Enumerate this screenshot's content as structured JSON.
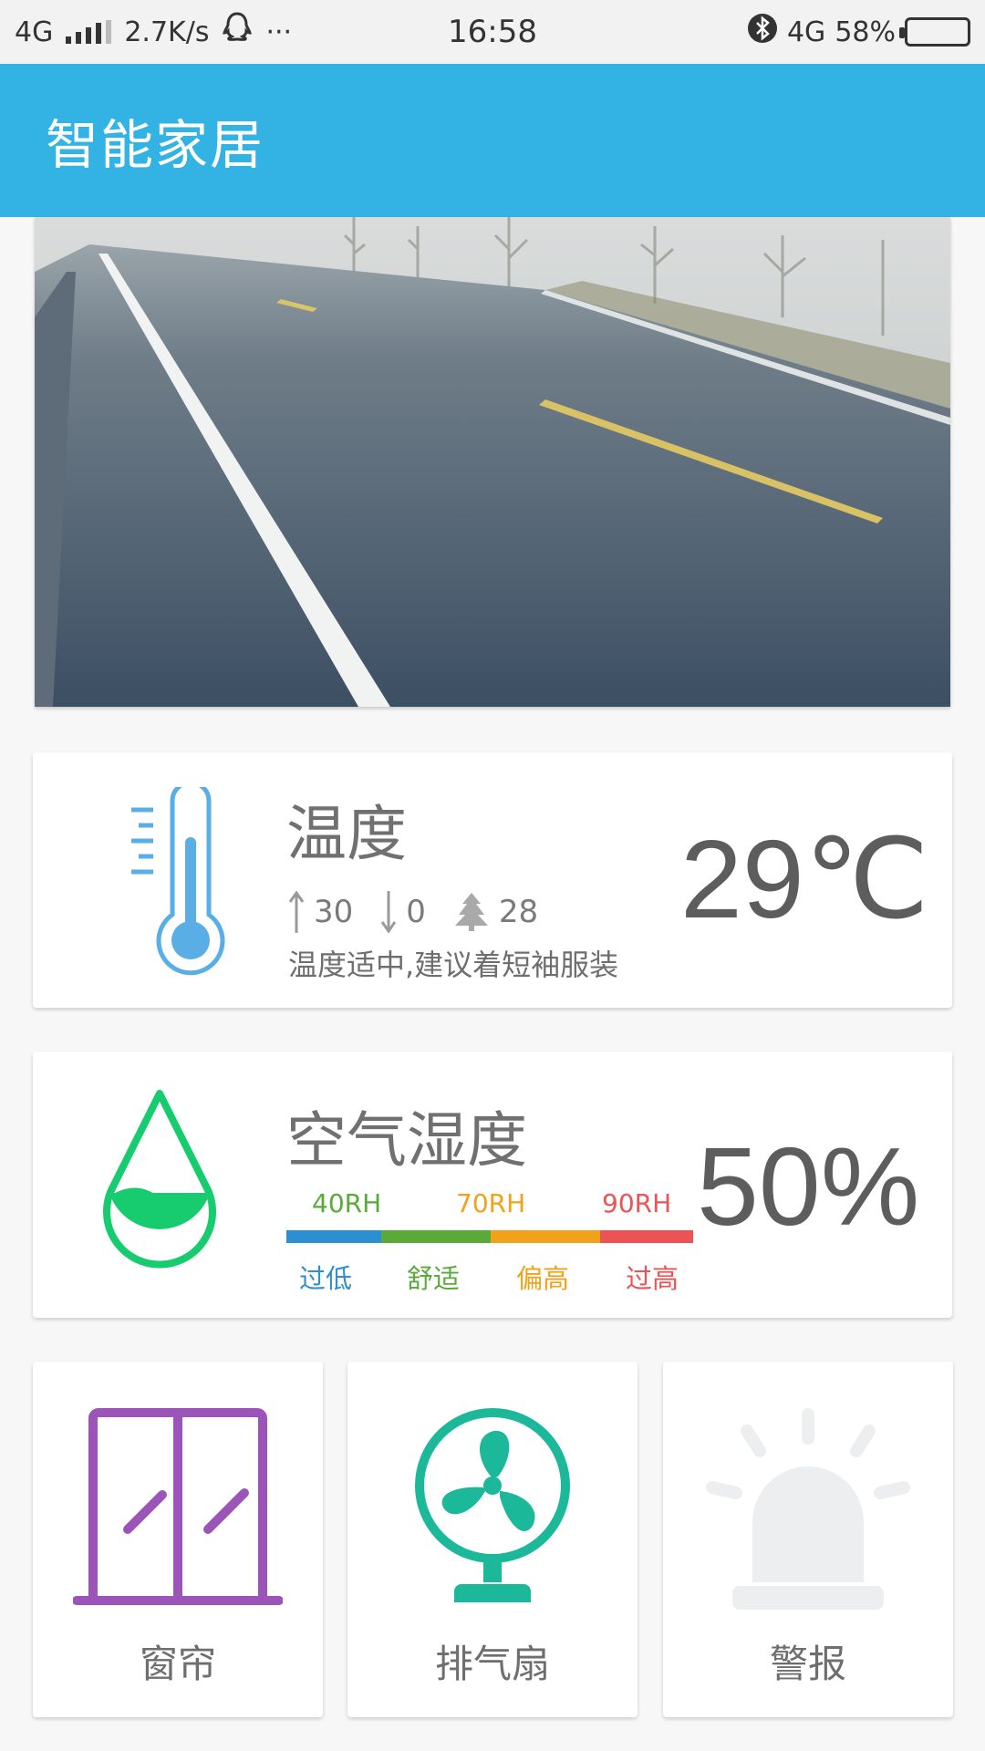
{
  "status_bar": {
    "network": "4G",
    "speed": "2.7K/s",
    "more": "···",
    "time": "16:58",
    "network_right": "4G",
    "battery": "58%",
    "battery_level": 0.58
  },
  "app_bar": {
    "title": "智能家居"
  },
  "temperature": {
    "title": "温度",
    "high": "30",
    "low": "0",
    "feels": "28",
    "advice": "温度适中,建议着短袖服装",
    "value": "29℃"
  },
  "humidity": {
    "title": "空气湿度",
    "value": "50%",
    "ticks": [
      "40RH",
      "70RH",
      "90RH"
    ],
    "zones": [
      "过低",
      "舒适",
      "偏高",
      "过高"
    ],
    "colors": {
      "low": "#2e8fd0",
      "comfort": "#5aaa3a",
      "high": "#f0a21a",
      "too_high": "#ea5455"
    }
  },
  "tiles": [
    {
      "label": "窗帘",
      "icon": "window-curtain-icon",
      "color": "#9b55b9"
    },
    {
      "label": "排气扇",
      "icon": "fan-icon",
      "color": "#1bb89a"
    },
    {
      "label": "警报",
      "icon": "alarm-light-icon",
      "color": "#eceef0"
    }
  ],
  "colors": {
    "accent": "#33b3e3",
    "thermo": "#5aaee6",
    "drop": "#17cc6e"
  }
}
